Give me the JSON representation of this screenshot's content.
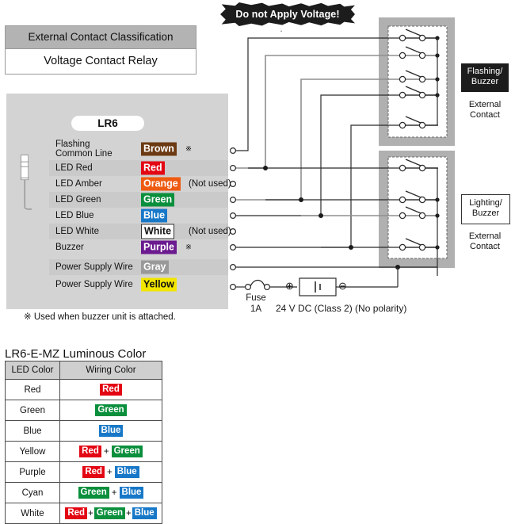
{
  "classification": {
    "header": "External Contact Classification",
    "value": "Voltage Contact Relay"
  },
  "warning": {
    "text": "Do not Apply Voltage!"
  },
  "device": {
    "model": "LR6",
    "footnote": "※  Used when buzzer unit is attached.",
    "wires": [
      {
        "name": "Flashing\nCommon Line",
        "chip": "Brown",
        "chip_bg": "#6b3a12",
        "chip_fg": "#ffffff",
        "mark": "※",
        "note": "",
        "band": false
      },
      {
        "name": "LED Red",
        "chip": "Red",
        "chip_bg": "#e30613",
        "chip_fg": "#ffffff",
        "mark": "",
        "note": "",
        "band": true
      },
      {
        "name": "LED Amber",
        "chip": "Orange",
        "chip_bg": "#ee5a10",
        "chip_fg": "#ffffff",
        "mark": "",
        "note": "(Not used)",
        "band": false
      },
      {
        "name": "LED Green",
        "chip": "Green",
        "chip_bg": "#0a8f3c",
        "chip_fg": "#ffffff",
        "mark": "",
        "note": "",
        "band": true
      },
      {
        "name": "LED Blue",
        "chip": "Blue",
        "chip_bg": "#1878c8",
        "chip_fg": "#ffffff",
        "mark": "",
        "note": "",
        "band": false
      },
      {
        "name": "LED White",
        "chip": "White",
        "chip_bg": "#ffffff",
        "chip_fg": "#111111",
        "mark": "",
        "note": "(Not used)",
        "band": true
      },
      {
        "name": "Buzzer",
        "chip": "Purple",
        "chip_bg": "#6b1a8f",
        "chip_fg": "#ffffff",
        "mark": "※",
        "note": "",
        "band": false
      },
      {
        "name": "Power Supply Wire",
        "chip": "Gray",
        "chip_bg": "#999999",
        "chip_fg": "#ffffff",
        "mark": "",
        "note": "",
        "band": true
      },
      {
        "name": "Power Supply Wire",
        "chip": "Yellow",
        "chip_bg": "#f2e500",
        "chip_fg": "#111111",
        "mark": "",
        "note": "",
        "band": false
      }
    ]
  },
  "side_labels": {
    "flashing": {
      "badge": "Flashing/\nBuzzer",
      "sub": "External\nContact"
    },
    "lighting": {
      "badge": "Lighting/\nBuzzer",
      "sub": "External\nContact"
    }
  },
  "power": {
    "fuse_label": "Fuse\n1A",
    "supply_label": "24 V DC (Class 2) (No polarity)",
    "plus": "⊕",
    "minus": "⊖"
  },
  "luminous_table": {
    "title": "LR6-E-MZ Luminous Color",
    "headers": [
      "LED Color",
      "Wiring Color"
    ],
    "rows": [
      {
        "led": "Red",
        "wiring": [
          {
            "label": "Red",
            "bg": "#e30613",
            "fg": "#ffffff"
          }
        ]
      },
      {
        "led": "Green",
        "wiring": [
          {
            "label": "Green",
            "bg": "#0a8f3c",
            "fg": "#ffffff"
          }
        ]
      },
      {
        "led": "Blue",
        "wiring": [
          {
            "label": "Blue",
            "bg": "#1878c8",
            "fg": "#ffffff"
          }
        ]
      },
      {
        "led": "Yellow",
        "wiring": [
          {
            "label": "Red",
            "bg": "#e30613",
            "fg": "#ffffff"
          },
          {
            "label": "Green",
            "bg": "#0a8f3c",
            "fg": "#ffffff"
          }
        ]
      },
      {
        "led": "Purple",
        "wiring": [
          {
            "label": "Red",
            "bg": "#e30613",
            "fg": "#ffffff"
          },
          {
            "label": "Blue",
            "bg": "#1878c8",
            "fg": "#ffffff"
          }
        ]
      },
      {
        "led": "Cyan",
        "wiring": [
          {
            "label": "Green",
            "bg": "#0a8f3c",
            "fg": "#ffffff"
          },
          {
            "label": "Blue",
            "bg": "#1878c8",
            "fg": "#ffffff"
          }
        ]
      },
      {
        "led": "White",
        "wiring": [
          {
            "label": "Red",
            "bg": "#e30613",
            "fg": "#ffffff"
          },
          {
            "label": "Green",
            "bg": "#0a8f3c",
            "fg": "#ffffff"
          },
          {
            "label": "Blue",
            "bg": "#1878c8",
            "fg": "#ffffff"
          }
        ],
        "tight": true
      }
    ],
    "separator": "+"
  }
}
